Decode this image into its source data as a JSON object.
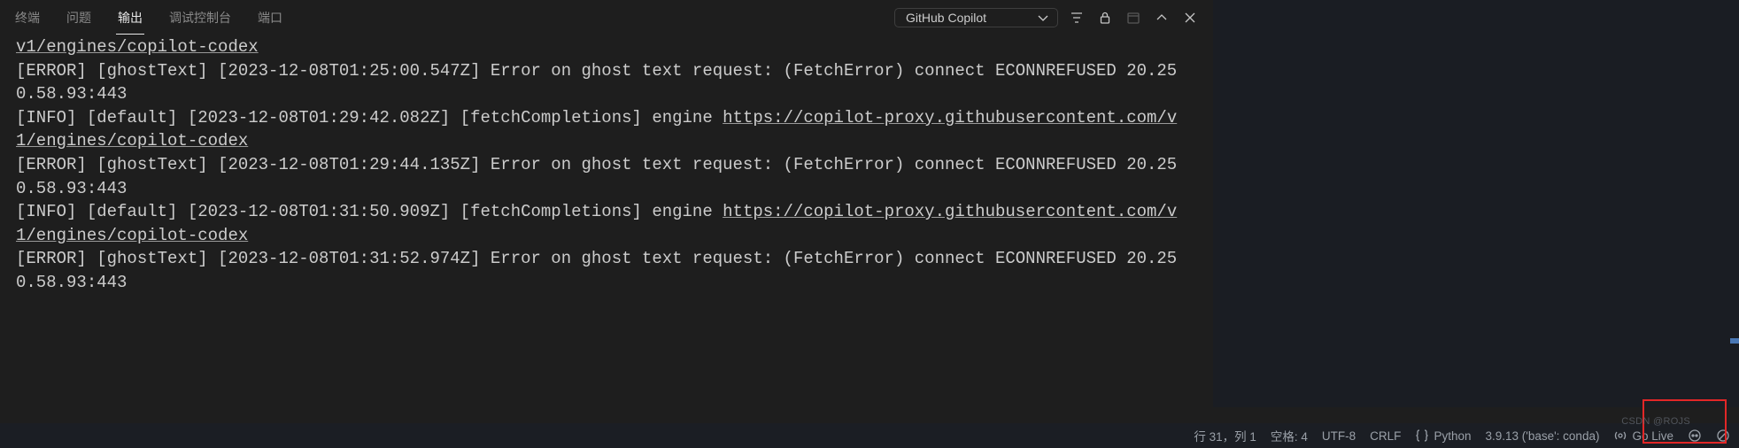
{
  "tabs": {
    "terminal": "终端",
    "problems": "问题",
    "output": "输出",
    "debug": "调试控制台",
    "ports": "端口"
  },
  "channel": {
    "selected": "GitHub Copilot"
  },
  "output": {
    "lines": [
      {
        "t": "url",
        "v": "v1/engines/copilot-codex"
      },
      {
        "t": "plain",
        "v": "[ERROR] [ghostText] [2023-12-08T01:25:00.547Z] Error on ghost text request: (FetchError) connect ECONNREFUSED 20.250.58.93:443"
      },
      {
        "t": "info",
        "prefix": "[INFO] [default] [2023-12-08T01:29:42.082Z] [fetchCompletions] engine ",
        "url": "https://copilot-proxy.githubusercontent.com/v1/engines/copilot-codex"
      },
      {
        "t": "plain",
        "v": "[ERROR] [ghostText] [2023-12-08T01:29:44.135Z] Error on ghost text request: (FetchError) connect ECONNREFUSED 20.250.58.93:443"
      },
      {
        "t": "info",
        "prefix": "[INFO] [default] [2023-12-08T01:31:50.909Z] [fetchCompletions] engine ",
        "url": "https://copilot-proxy.githubusercontent.com/v1/engines/copilot-codex"
      },
      {
        "t": "plain",
        "v": "[ERROR] [ghostText] [2023-12-08T01:31:52.974Z] Error on ghost text request: (FetchError) connect ECONNREFUSED 20.250.58.93:443"
      }
    ]
  },
  "status": {
    "cursor": "行 31，列 1",
    "spaces": "空格: 4",
    "encoding": "UTF-8",
    "eol": "CRLF",
    "language": "Python",
    "interpreter": "3.9.13 ('base': conda)",
    "golive": "Go Live"
  }
}
